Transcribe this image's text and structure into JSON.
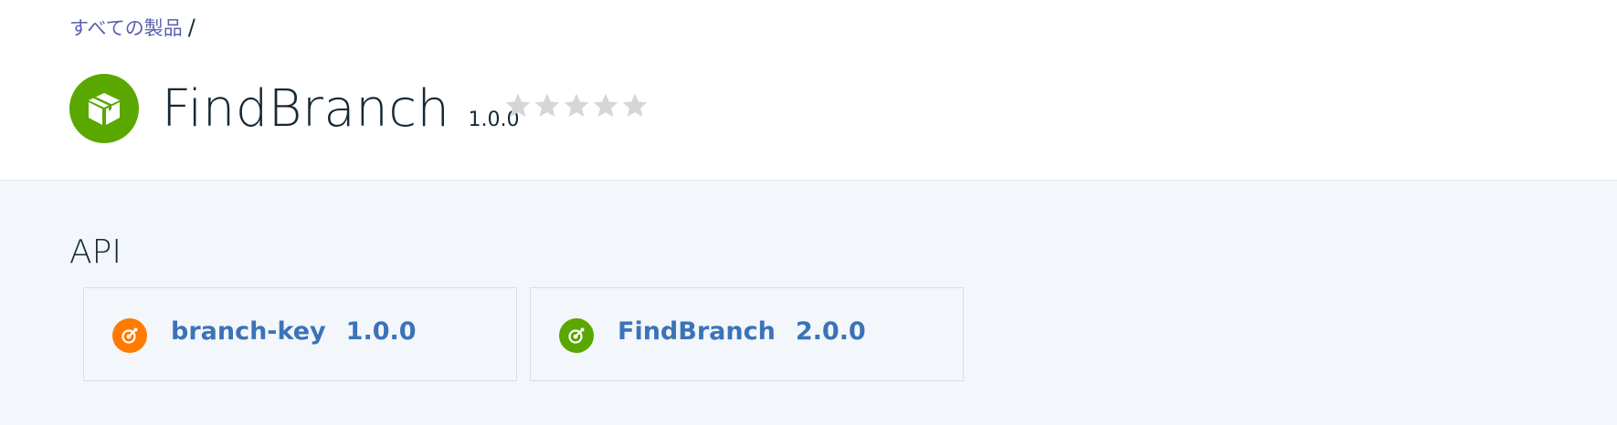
{
  "breadcrumb": {
    "link": "すべての製品",
    "separator": "/"
  },
  "product": {
    "title": "FindBranch",
    "version": "1.0.0",
    "icon": "package-icon",
    "icon_color": "#5aa700",
    "rating": 0,
    "max_rating": 5
  },
  "api_section": {
    "title": "API",
    "items": [
      {
        "name": "branch-key",
        "version": "1.0.0",
        "icon": "api-icon",
        "color": "#ff7b00"
      },
      {
        "name": "FindBranch",
        "version": "2.0.0",
        "icon": "api-icon",
        "color": "#5aa700"
      }
    ]
  },
  "colors": {
    "link": "#5a5fb0",
    "api_link": "#3b73b9",
    "text": "#152935",
    "star_empty": "#d6d6d6",
    "background": "#f3f6fa"
  }
}
